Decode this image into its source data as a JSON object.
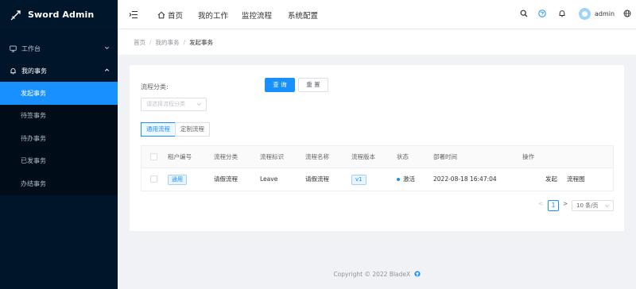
{
  "app": {
    "title": "Sword Admin"
  },
  "colors": {
    "sidebar": "#001529",
    "accent": "#1890ff",
    "background": "#f0f2f5"
  },
  "sidebar": {
    "groups": [
      {
        "label": "工作台",
        "icon": "monitor-icon",
        "expanded": false
      },
      {
        "label": "我的事务",
        "icon": "bell-icon",
        "expanded": true
      }
    ],
    "items": [
      {
        "label": "发起事务",
        "active": true
      },
      {
        "label": "待签事务",
        "active": false
      },
      {
        "label": "待办事务",
        "active": false
      },
      {
        "label": "已发事务",
        "active": false
      },
      {
        "label": "办结事务",
        "active": false
      }
    ]
  },
  "topnav": {
    "home": "首页",
    "work": "我的工作",
    "monitor": "监控流程",
    "settings": "系统配置",
    "username": "admin"
  },
  "breadcrumb": {
    "home": "首页",
    "parent": "我的事务",
    "current": "发起事务"
  },
  "search": {
    "label": "流程分类:",
    "placeholder": "请选择流程分类",
    "query_button": "查 询",
    "reset_button": "重 置"
  },
  "tabs": [
    {
      "label": "通用流程",
      "active": true
    },
    {
      "label": "定制流程",
      "active": false
    }
  ],
  "table": {
    "headers": [
      "租户编号",
      "流程分类",
      "流程标识",
      "流程名称",
      "流程版本",
      "状态",
      "部署时间",
      "操作"
    ],
    "rows": [
      {
        "tenant": "通用",
        "category": "请假流程",
        "key": "Leave",
        "name": "请假流程",
        "version": "v1",
        "status": "激活",
        "deploy_time": "2022-08-18 16:47:04",
        "actions": [
          "发起",
          "流程图"
        ]
      }
    ]
  },
  "pagination": {
    "prev": "<",
    "page": "1",
    "next": ">",
    "page_size": "10 条/页"
  },
  "footer": {
    "text": "Copyright © 2022 BladeX"
  }
}
